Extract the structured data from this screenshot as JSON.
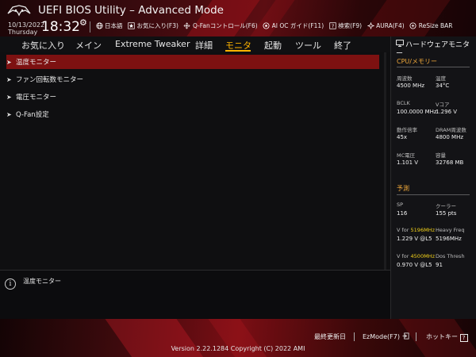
{
  "header": {
    "title": "UEFI BIOS Utility – Advanced Mode",
    "date": "10/13/2022",
    "weekday": "Thursday",
    "time": "18:32",
    "quick_links": [
      {
        "icon": "globe-icon",
        "label": "日本語"
      },
      {
        "icon": "star-icon",
        "label": "お気に入り(F3)"
      },
      {
        "icon": "fan-icon",
        "label": "Q-Fanコントロール(F6)"
      },
      {
        "icon": "ai-icon",
        "label": "AI OC ガイド(F11)"
      },
      {
        "icon": "help-icon",
        "label": "検索(F9)"
      },
      {
        "icon": "aura-icon",
        "label": "AURA(F4)"
      },
      {
        "icon": "resize-bar-icon",
        "label": "ReSize BAR"
      }
    ]
  },
  "menu": {
    "items": [
      "お気に入り",
      "メイン",
      "Extreme Tweaker",
      "詳細",
      "モニタ",
      "起動",
      "ツール",
      "終了"
    ],
    "active_index": 4
  },
  "main": {
    "items": [
      {
        "label": "温度モニター",
        "selected": true
      },
      {
        "label": "ファン回転数モニター",
        "selected": false
      },
      {
        "label": "電圧モニター",
        "selected": false
      },
      {
        "label": "Q-Fan設定",
        "selected": false
      }
    ]
  },
  "info": {
    "text": "温度モニター"
  },
  "hardware_monitor": {
    "title": "ハードウェアモニター",
    "cpu_section": "CPU/メモリー",
    "rows": [
      {
        "l1": "周波数",
        "v1": "4500 MHz",
        "l2": "温度",
        "v2": "34°C"
      },
      {
        "l1": "BCLK",
        "v1": "100.0000 MHz",
        "l2": "Vコア",
        "v2": "1.296 V"
      },
      {
        "l1": "動作倍率",
        "v1": "45x",
        "l2": "DRAM周波数",
        "v2": "4800 MHz"
      },
      {
        "l1": "MC電圧",
        "v1": "1.101 V",
        "l2": "容量",
        "v2": "32768 MB"
      }
    ],
    "prediction_section": "予測",
    "prediction": {
      "sp_label": "SP",
      "sp_value": "116",
      "cooler_label": "クーラー",
      "cooler_value": "155 pts",
      "v_for_prefix": "V for",
      "freq1": "5196MHz",
      "v1": "1.229 V @L5",
      "heavy_freq_label": "Heavy Freq",
      "heavy_freq_value": "5196MHz",
      "freq2": "4500MHz",
      "v2": "0.970 V @L5",
      "dos_thresh_label": "Dos Thresh",
      "dos_thresh_value": "91"
    }
  },
  "footer": {
    "last_modified": "最終更新日",
    "ezmode": "EzMode(F7)",
    "hotkey": "ホットキー",
    "hotkey_symbol": "?",
    "copyright": "Version 2.22.1284 Copyright (C) 2022 AMI"
  },
  "colors": {
    "accent": "#ffb400",
    "selected_row": "#7d1111",
    "section_header": "#f0a83a",
    "highlight_freq": "#f3d21a"
  }
}
